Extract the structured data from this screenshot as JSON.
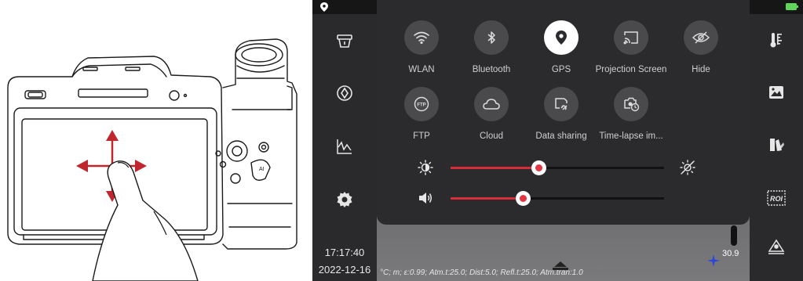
{
  "status_bar": {
    "location_icon": "map-pin-icon",
    "battery_icon": "battery-icon",
    "battery_color": "#5fd35a"
  },
  "left_rail": {
    "items": [
      {
        "name": "lamp-icon"
      },
      {
        "name": "focus-icon"
      },
      {
        "name": "analysis-chart-icon"
      },
      {
        "name": "settings-gear-icon"
      }
    ],
    "time": "17:17:40",
    "date": "2022-12-16"
  },
  "right_rail": {
    "items": [
      {
        "name": "temperature-scale-icon"
      },
      {
        "name": "gallery-icon"
      },
      {
        "name": "palette-icon"
      },
      {
        "name": "roi-icon",
        "label": "ROI"
      },
      {
        "name": "measure-icon"
      }
    ]
  },
  "control_center": {
    "tiles": [
      {
        "label": "WLAN",
        "icon": "wifi-icon",
        "active": false
      },
      {
        "label": "Bluetooth",
        "icon": "bluetooth-icon",
        "active": false
      },
      {
        "label": "GPS",
        "icon": "gps-icon",
        "active": true
      },
      {
        "label": "Projection Screen",
        "icon": "cast-icon",
        "active": false
      },
      {
        "label": "Hide",
        "icon": "eye-off-icon",
        "active": false
      },
      {
        "label": "FTP",
        "icon": "ftp-icon",
        "active": false,
        "icon_text": "FTP"
      },
      {
        "label": "Cloud",
        "icon": "cloud-icon",
        "active": false
      },
      {
        "label": "Data sharing",
        "icon": "data-sharing-icon",
        "active": false
      },
      {
        "label": "Time-lapse im...",
        "icon": "timelapse-icon",
        "active": false
      }
    ],
    "brightness": {
      "level": 0.41,
      "icon": "brightness-icon",
      "end_icon": "auto-brightness-off-icon"
    },
    "volume": {
      "level": 0.34,
      "icon": "volume-icon"
    }
  },
  "image_overlay": {
    "params": "°C; m; ε:0.99; Atm.t:25.0; Dist:5.0; Refl.t:25.0; Atm.tran:1.0",
    "spot_temp": "30.9"
  },
  "accent_color": "#d62c3a"
}
